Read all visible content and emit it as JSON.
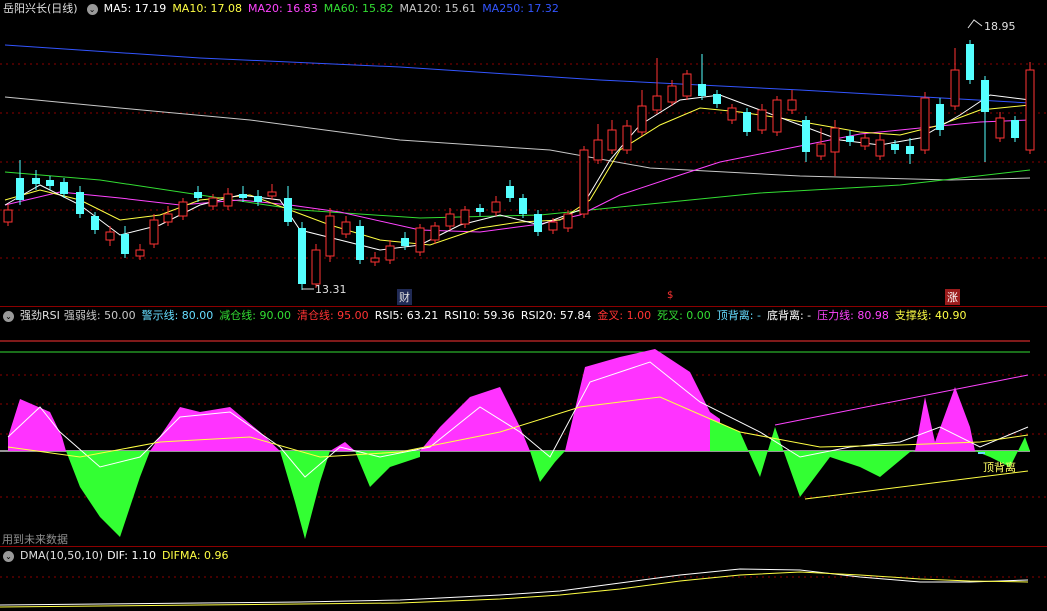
{
  "main": {
    "title": "岳阳兴长(日线)",
    "indicators": [
      {
        "label": "MA5: 17.19",
        "color": "#ffffff"
      },
      {
        "label": "MA10: 17.08",
        "color": "#ffff44"
      },
      {
        "label": "MA20: 16.83",
        "color": "#ff44ff"
      },
      {
        "label": "MA60: 15.82",
        "color": "#33dd33"
      },
      {
        "label": "MA120: 15.61",
        "color": "#c8c8c8"
      },
      {
        "label": "MA250: 17.32",
        "color": "#3355ff"
      }
    ],
    "high_label": "18.95",
    "low_label": "13.31",
    "markers": [
      "财",
      "$",
      "涨"
    ]
  },
  "rsi": {
    "title": "强劲RSI",
    "indicators": [
      {
        "label": "强弱线: 50.00",
        "color": "#c8c8c8"
      },
      {
        "label": "警示线: 80.00",
        "color": "#66ddff"
      },
      {
        "label": "减仓线: 90.00",
        "color": "#33dd33"
      },
      {
        "label": "清仓线: 95.00",
        "color": "#ff3333"
      },
      {
        "label": "RSI5: 63.21",
        "color": "#ffffff"
      },
      {
        "label": "RSI10: 59.36",
        "color": "#ffffff"
      },
      {
        "label": "RSI20: 57.84",
        "color": "#ffffff"
      },
      {
        "label": "金叉: 1.00",
        "color": "#ff3333"
      },
      {
        "label": "死叉: 0.00",
        "color": "#33dd33"
      },
      {
        "label": "顶背离: -",
        "color": "#66ddff"
      },
      {
        "label": "底背离: -",
        "color": "#ffffff"
      },
      {
        "label": "压力线: 80.98",
        "color": "#ff44ff"
      },
      {
        "label": "支撑线: 40.90",
        "color": "#ffff44"
      }
    ],
    "divergence_label": "顶背离",
    "future_note": "用到未来数据"
  },
  "dma": {
    "title": "DMA(10,50,10)",
    "indicators": [
      {
        "label": "DIF: 1.10",
        "color": "#ffffff"
      },
      {
        "label": "DIFMA: 0.96",
        "color": "#ffff44"
      }
    ]
  },
  "colors": {
    "up": "#ff3333",
    "down": "#55ffff",
    "rsi_pos": "#ff33ff",
    "rsi_neg": "#33ff33",
    "grid": "#8b0000"
  }
}
